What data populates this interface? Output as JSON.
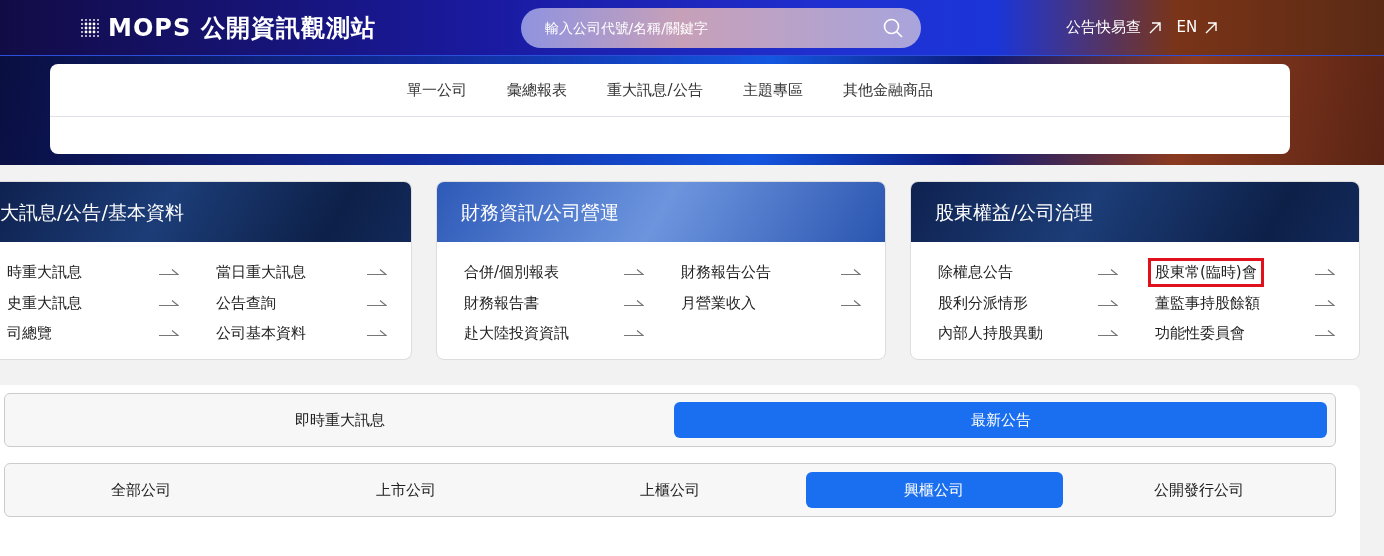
{
  "header": {
    "logo_text": "MOPS 公開資訊觀測站",
    "search": {
      "placeholder": "輸入公司代號/名稱/關鍵字"
    },
    "links": [
      {
        "label": "公告快易查"
      },
      {
        "label": "EN"
      }
    ]
  },
  "nav": {
    "items": [
      {
        "label": "單一公司"
      },
      {
        "label": "彙總報表"
      },
      {
        "label": "重大訊息/公告"
      },
      {
        "label": "主題專區"
      },
      {
        "label": "其他金融商品"
      }
    ]
  },
  "cards": [
    {
      "title": "大訊息/公告/基本資料",
      "kind": "dark",
      "links": [
        {
          "label": "時重大訊息",
          "highlighted": false
        },
        {
          "label": "當日重大訊息",
          "highlighted": false
        },
        {
          "label": "史重大訊息",
          "highlighted": false
        },
        {
          "label": "公告查詢",
          "highlighted": false
        },
        {
          "label": "司總覽",
          "highlighted": false
        },
        {
          "label": "公司基本資料",
          "highlighted": false
        }
      ]
    },
    {
      "title": "財務資訊/公司營運",
      "kind": "light",
      "links": [
        {
          "label": "合併/個別報表",
          "highlighted": false
        },
        {
          "label": "財務報告公告",
          "highlighted": false
        },
        {
          "label": "財務報告書",
          "highlighted": false
        },
        {
          "label": "月營業收入",
          "highlighted": false
        },
        {
          "label": "赴大陸投資資訊",
          "highlighted": false
        }
      ]
    },
    {
      "title": "股東權益/公司治理",
      "kind": "dark",
      "links": [
        {
          "label": "除權息公告",
          "highlighted": false
        },
        {
          "label": "股東常(臨時)會",
          "highlighted": true
        },
        {
          "label": "股利分派情形",
          "highlighted": false
        },
        {
          "label": "董監事持股餘額",
          "highlighted": false
        },
        {
          "label": "內部人持股異動",
          "highlighted": false
        },
        {
          "label": "功能性委員會",
          "highlighted": false
        }
      ]
    }
  ],
  "tab_groups": [
    {
      "tabs": [
        {
          "label": "即時重大訊息",
          "selected": false
        },
        {
          "label": "最新公告",
          "selected": true
        }
      ]
    },
    {
      "tabs": [
        {
          "label": "全部公司",
          "selected": false
        },
        {
          "label": "上市公司",
          "selected": false
        },
        {
          "label": "上櫃公司",
          "selected": false
        },
        {
          "label": "興櫃公司",
          "selected": true
        },
        {
          "label": "公開發行公司",
          "selected": false
        }
      ]
    }
  ]
}
